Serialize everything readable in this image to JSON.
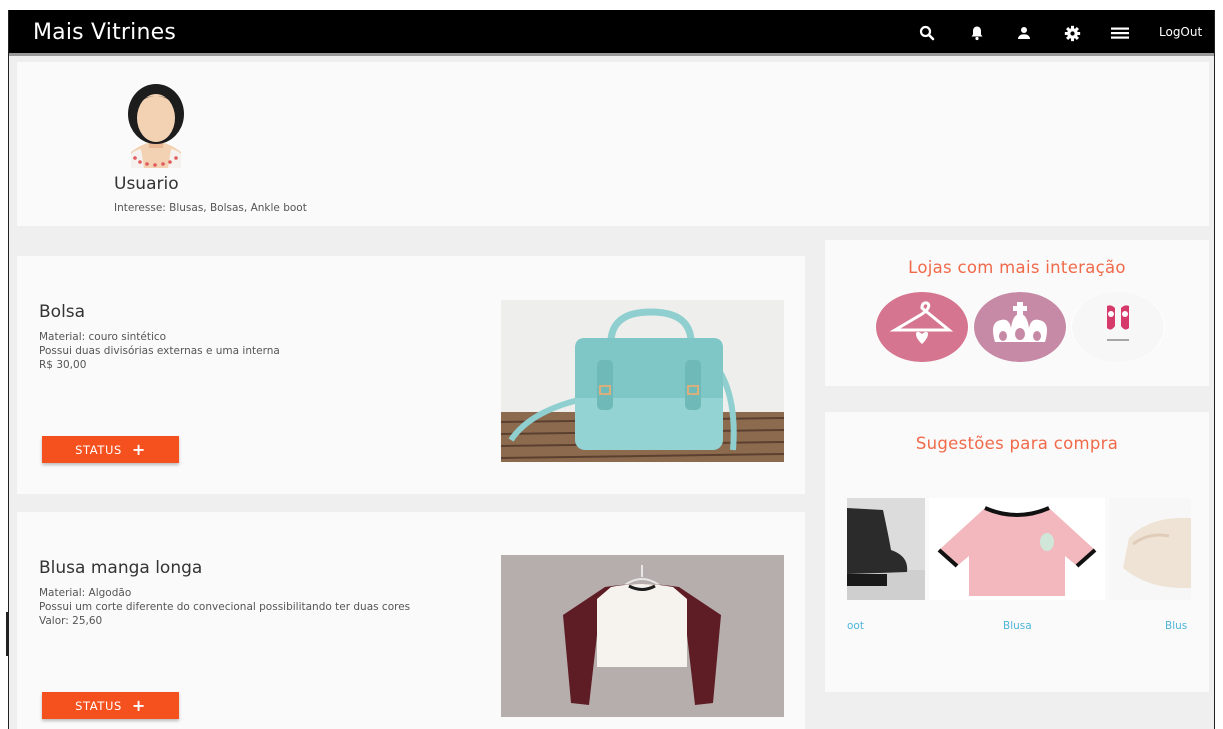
{
  "header": {
    "brand": "Mais Vitrines",
    "icons": [
      "search-icon",
      "bell-icon",
      "user-icon",
      "gear-icon",
      "menu-icon"
    ],
    "logout_label": "LogOut"
  },
  "profile": {
    "name": "Usuario",
    "interest": "Interesse: Blusas, Bolsas, Ankle boot"
  },
  "products": [
    {
      "title": "Bolsa",
      "lines": [
        "Material: couro sintético",
        "Possui duas divisórias externas e uma interna",
        "R$ 30,00"
      ],
      "status_label": "STATUS",
      "image": "teal-satchel-bag"
    },
    {
      "title": "Blusa manga longa",
      "lines": [
        "Material: Algodão",
        "Possui um corte diferente do convecional possibilitando ter duas cores",
        "Valor: 25,60"
      ],
      "status_label": "STATUS",
      "image": "raglan-crop-top"
    }
  ],
  "stores": {
    "title": "Lojas com mais interação",
    "logos": [
      "hanger-heart-logo",
      "crown-logo",
      "shoe-logo"
    ]
  },
  "suggestions": {
    "title": "Sugestões para compra",
    "items": [
      {
        "label": "oot",
        "image": "ankle-boot"
      },
      {
        "label": "Blusa",
        "image": "pink-tshirt"
      },
      {
        "label": "Blus",
        "image": "beige-blouse"
      }
    ]
  },
  "colors": {
    "navbar": "#000000",
    "accent": "#f4511e",
    "title_accent": "#f06a4a",
    "link": "#4fb5d8",
    "store_pink": "#d5758f",
    "store_mauve": "#c78aa6"
  }
}
